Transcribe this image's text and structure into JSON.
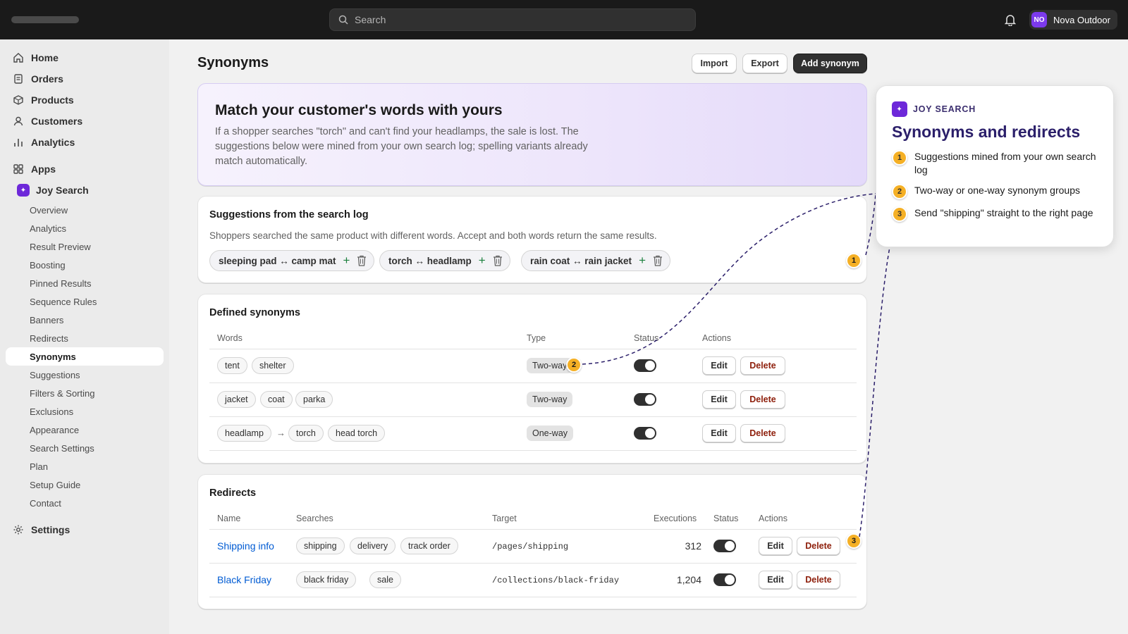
{
  "topbar": {
    "search_placeholder": "Search",
    "store_initials": "NO",
    "store_name": "Nova Outdoor"
  },
  "sidebar": {
    "main": [
      "Home",
      "Orders",
      "Products",
      "Customers",
      "Analytics"
    ],
    "apps_label": "Apps",
    "app_name": "Joy Search",
    "app_items": [
      "Overview",
      "Analytics",
      "Result Preview",
      "Boosting",
      "Pinned Results",
      "Sequence Rules",
      "Banners",
      "Redirects",
      "Synonyms",
      "Suggestions",
      "Filters & Sorting",
      "Exclusions",
      "Appearance",
      "Search Settings",
      "Plan",
      "Setup Guide",
      "Contact"
    ],
    "active_item": "Synonyms",
    "settings_label": "Settings"
  },
  "page": {
    "title": "Synonyms",
    "import_label": "Import",
    "export_label": "Export",
    "add_label": "Add synonym"
  },
  "hero": {
    "title": "Match your customer's words with yours",
    "body": "If a shopper searches \"torch\" and can't find your headlamps, the sale is lost. The suggestions below were mined from your own search log; spelling variants already match automatically."
  },
  "suggestions": {
    "title": "Suggestions from the search log",
    "description": "Shoppers searched the same product with different words. Accept and both words return the same results.",
    "items": [
      "sleeping pad ↔ camp mat",
      "torch ↔ headlamp",
      "rain coat ↔ rain jacket"
    ],
    "accept_glyph": "+"
  },
  "synonyms": {
    "title": "Defined synonyms",
    "headers": [
      "Words",
      "Type",
      "Status",
      "Actions"
    ],
    "rows": [
      {
        "words": [
          "tent",
          "shelter"
        ],
        "type": "Two-way"
      },
      {
        "words": [
          "jacket",
          "coat",
          "parka"
        ],
        "type": "Two-way"
      },
      {
        "from": "headlamp",
        "arrow": "→",
        "words": [
          "torch",
          "head torch"
        ],
        "type": "One-way"
      }
    ],
    "edit_label": "Edit",
    "delete_label": "Delete"
  },
  "redirects": {
    "title": "Redirects",
    "headers": [
      "Name",
      "Searches",
      "Target",
      "Executions",
      "Status",
      "Actions"
    ],
    "rows": [
      {
        "name": "Shipping info",
        "searches": [
          "shipping",
          "delivery",
          "track order"
        ],
        "target": "/pages/shipping",
        "executions": "312"
      },
      {
        "name": "Black Friday",
        "searches": [
          "black friday",
          "sale"
        ],
        "target": "/collections/black-friday",
        "executions": "1,204"
      }
    ]
  },
  "callout": {
    "brand": "JOY SEARCH",
    "title": "Synonyms and redirects",
    "steps": [
      {
        "n": "1",
        "text": "Suggestions mined from your own search log"
      },
      {
        "n": "2",
        "text": "Two-way or one-way synonym groups"
      },
      {
        "n": "3",
        "text": "Send \"shipping\" straight to the right page"
      }
    ]
  },
  "colors": {
    "accent": "#f5b025",
    "callout_title": "#2b1f6a",
    "link": "#005bd3",
    "danger": "#8e1f0b"
  }
}
